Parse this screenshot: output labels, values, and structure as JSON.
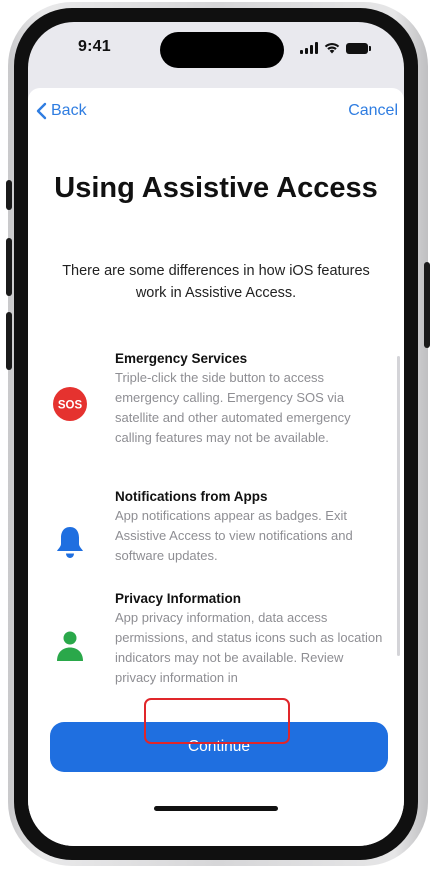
{
  "status_bar": {
    "time": "9:41",
    "icons": [
      "signal-icon",
      "wifi-icon",
      "battery-icon"
    ]
  },
  "nav": {
    "back_label": "Back",
    "back_icon": "chevron-left-icon",
    "cancel_label": "Cancel"
  },
  "page": {
    "title": "Using Assistive Access",
    "subtitle": "There are some differences in how iOS features work in Assistive Access."
  },
  "features": [
    {
      "title": "Emergency Services",
      "description": "Triple-click the side button to access emergency calling. Emergency SOS via satellite and other automated emergency calling features may not be available.",
      "icon": "sos-icon",
      "icon_label": "SOS"
    },
    {
      "title": "Notifications from Apps",
      "description": "App notifications appear as badges. Exit Assistive Access to view notifications and software updates.",
      "icon": "bell-icon"
    },
    {
      "title": "Privacy Information",
      "description": "App privacy information, data access permissions, and status icons such as location indicators may not be available. Review privacy information in",
      "icon": "person-icon"
    }
  ],
  "actions": {
    "continue_label": "Continue"
  },
  "colors": {
    "accent": "#2f7de1",
    "button": "#1f6fe0",
    "sos_red": "#e5322f",
    "bell_blue": "#1f6fe0",
    "person_green": "#2aa84a",
    "highlight": "#e0262a",
    "secondary_text": "#8e8e93"
  }
}
